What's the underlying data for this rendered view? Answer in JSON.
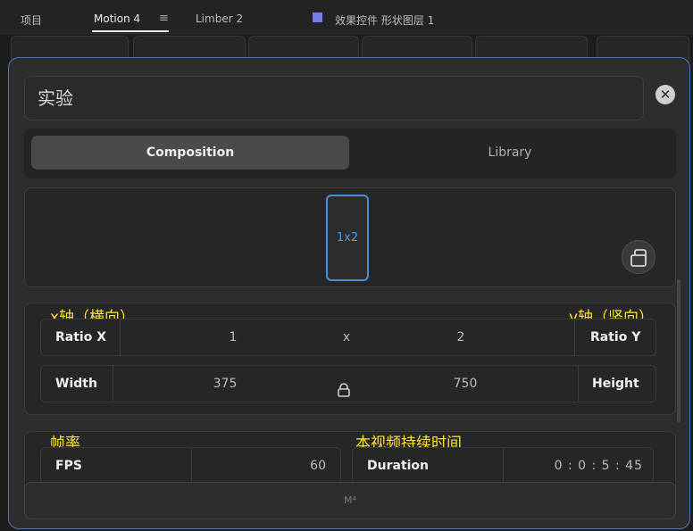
{
  "panel_tabs": {
    "project": "项目",
    "motion": "Motion 4",
    "limber": "Limber 2",
    "effects": "效果控件 形状图层 1"
  },
  "modal": {
    "name_value": "实验",
    "close_glyph": "✕",
    "segment": {
      "composition": "Composition",
      "library": "Library"
    },
    "preview": {
      "ratio_label": "1x2"
    },
    "annotations": {
      "x_axis": "x轴（横向）",
      "y_axis": "y轴（竖向）",
      "fps": "帧率",
      "duration": "本视频持续时间"
    },
    "ratio": {
      "x_label": "Ratio X",
      "x_value": "1",
      "sep": "x",
      "y_value": "2",
      "y_label": "Ratio Y"
    },
    "size": {
      "width_label": "Width",
      "width_value": "375",
      "height_value": "750",
      "height_label": "Height"
    },
    "timing": {
      "fps_label": "FPS",
      "fps_value": "60",
      "duration_label": "Duration",
      "duration_value": "0 : 0 : 5 : 45"
    },
    "footer_button": "M⁴"
  },
  "icons": {
    "menu": "hamburger-icon",
    "close": "close-icon",
    "copy": "copy-icon",
    "lock": "lock-icon"
  },
  "colors": {
    "accent_blue": "#4a8fd4",
    "annotation_yellow": "#ffe52b",
    "swatch": "#6f7fe6"
  }
}
